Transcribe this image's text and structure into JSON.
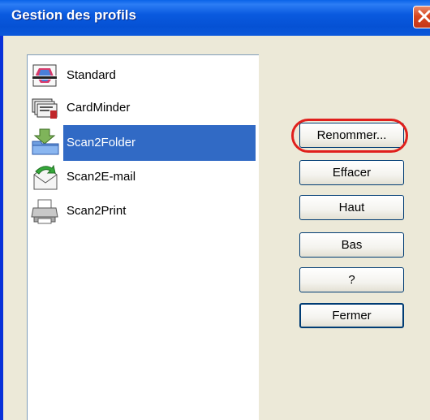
{
  "window": {
    "title": "Gestion des profils",
    "close_icon": "close-icon"
  },
  "profiles": [
    {
      "label": "Standard",
      "icon": "scanner-app-icon",
      "selected": false
    },
    {
      "label": "CardMinder",
      "icon": "card-scanner-icon",
      "selected": false
    },
    {
      "label": "Scan2Folder",
      "icon": "folder-scan-icon",
      "selected": true
    },
    {
      "label": "Scan2E-mail",
      "icon": "email-scan-icon",
      "selected": false
    },
    {
      "label": "Scan2Print",
      "icon": "printer-icon",
      "selected": false
    }
  ],
  "buttons": {
    "rename": "Renommer...",
    "delete": "Effacer",
    "up": "Haut",
    "down": "Bas",
    "help": "?",
    "close": "Fermer"
  },
  "colors": {
    "titlebar": "#0a5adf",
    "selection": "#316ac5",
    "highlight": "#e0201c"
  }
}
